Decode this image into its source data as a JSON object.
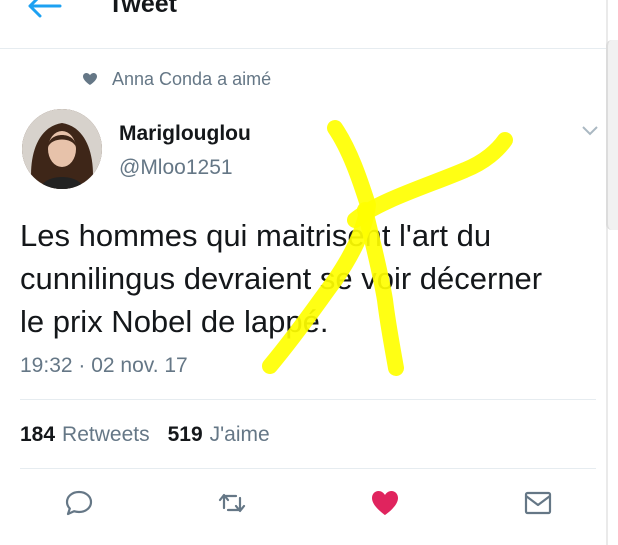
{
  "header": {
    "title": "Tweet",
    "back_icon": "arrow-left-icon",
    "accent": "#1da1f2"
  },
  "social_context": {
    "icon": "heart-icon",
    "text": "Anna Conda a aimé"
  },
  "tweet": {
    "author_name": "Mariglouglou",
    "author_handle": "@Mloo1251",
    "text": "Les hommes qui maitrisent l'art du\ncunnilingus devraient se voir décerner\nle prix Nobel de lappé.",
    "timestamp": "19:32 · 02 nov. 17",
    "retweets_count": "184",
    "retweets_label": "Retweets",
    "likes_count": "519",
    "likes_label": "J'aime"
  },
  "actions": {
    "reply_icon": "reply-icon",
    "retweet_icon": "retweet-icon",
    "like_icon": "heart-icon",
    "like_color": "#e0245e",
    "message_icon": "envelope-icon"
  },
  "annotation_color": "#ffff00"
}
